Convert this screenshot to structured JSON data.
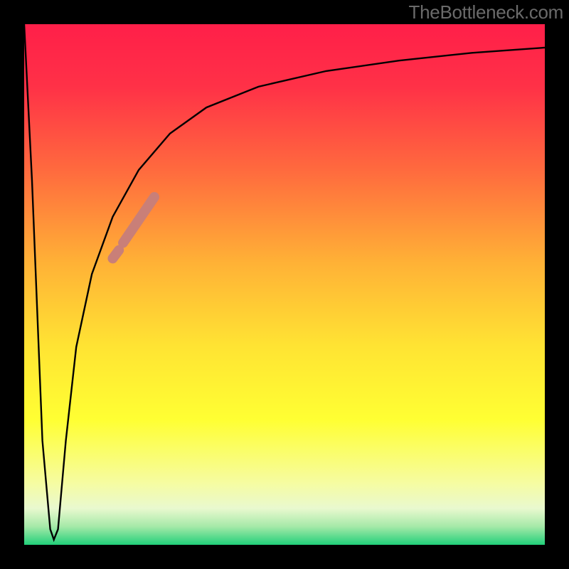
{
  "watermark": "TheBottleneck.com",
  "colors": {
    "frame": "#000000",
    "curve": "#000000",
    "highlight": "#c97f78",
    "gradient_stops": [
      {
        "offset": 0.0,
        "color": "#ff1f49"
      },
      {
        "offset": 0.12,
        "color": "#ff3147"
      },
      {
        "offset": 0.28,
        "color": "#ff6a3e"
      },
      {
        "offset": 0.46,
        "color": "#ffb236"
      },
      {
        "offset": 0.62,
        "color": "#ffe433"
      },
      {
        "offset": 0.76,
        "color": "#ffff33"
      },
      {
        "offset": 0.88,
        "color": "#f6fca0"
      },
      {
        "offset": 0.93,
        "color": "#e9f9cf"
      },
      {
        "offset": 0.965,
        "color": "#a5e9a8"
      },
      {
        "offset": 1.0,
        "color": "#21d07a"
      }
    ]
  },
  "chart_data": {
    "type": "line",
    "title": "",
    "xlabel": "",
    "ylabel": "",
    "xlim": [
      0,
      100
    ],
    "ylim": [
      0,
      100
    ],
    "series": [
      {
        "name": "bottleneck-curve",
        "x": [
          0.0,
          1.5,
          3.5,
          5.0,
          5.7,
          6.5,
          8.0,
          10.0,
          13.0,
          17.0,
          22.0,
          28.0,
          35.0,
          45.0,
          58.0,
          72.0,
          86.0,
          100.0
        ],
        "y": [
          100,
          70,
          20,
          3,
          1,
          3,
          20,
          38,
          52,
          63,
          72,
          79,
          84,
          88,
          91,
          93,
          94.5,
          95.5
        ]
      }
    ],
    "highlights": [
      {
        "name": "segment-lower",
        "x": [
          17.0,
          18.2
        ],
        "y": [
          55.0,
          56.6
        ],
        "width": 14
      },
      {
        "name": "segment-upper",
        "x": [
          19.0,
          25.0
        ],
        "y": [
          58.0,
          66.8
        ],
        "width": 14
      }
    ]
  }
}
